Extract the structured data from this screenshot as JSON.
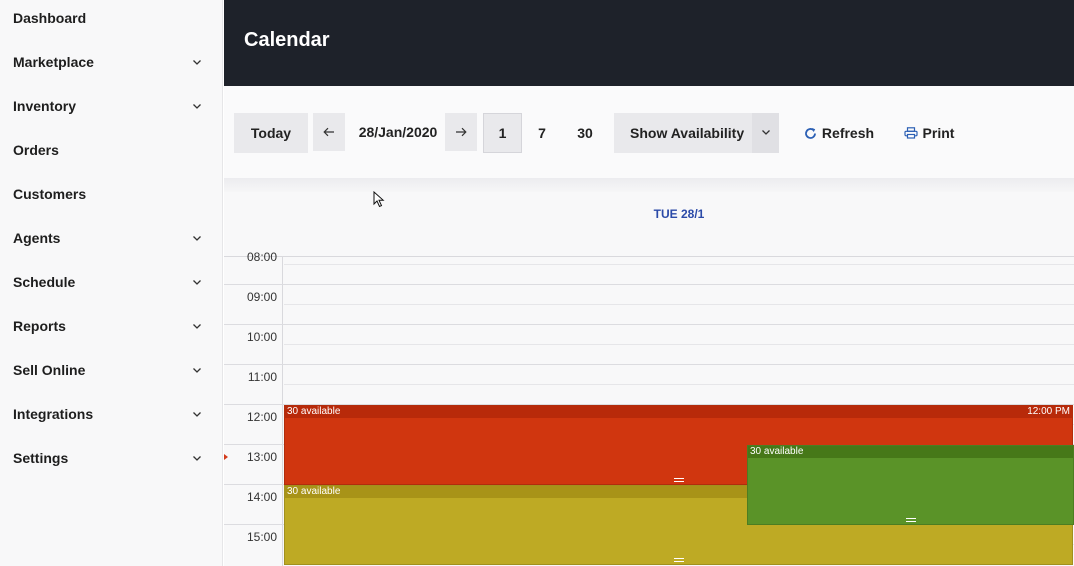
{
  "sidebar": {
    "items": [
      {
        "label": "Dashboard",
        "expandable": false
      },
      {
        "label": "Marketplace",
        "expandable": true
      },
      {
        "label": "Inventory",
        "expandable": true
      },
      {
        "label": "Orders",
        "expandable": false
      },
      {
        "label": "Customers",
        "expandable": false
      },
      {
        "label": "Agents",
        "expandable": true
      },
      {
        "label": "Schedule",
        "expandable": true
      },
      {
        "label": "Reports",
        "expandable": true
      },
      {
        "label": "Sell Online",
        "expandable": true
      },
      {
        "label": "Integrations",
        "expandable": true
      },
      {
        "label": "Settings",
        "expandable": true
      }
    ]
  },
  "header": {
    "title": "Calendar"
  },
  "toolbar": {
    "today_label": "Today",
    "prev_icon": "arrow-left-icon",
    "date_label": "28/Jan/2020",
    "next_icon": "arrow-right-icon",
    "day_1": "1",
    "day_7": "7",
    "day_30": "30",
    "availability_label": "Show Availability",
    "refresh_label": "Refresh",
    "print_label": "Print"
  },
  "calendar": {
    "day_header": "TUE 28/1",
    "time_labels": [
      "08:00",
      "09:00",
      "10:00",
      "11:00",
      "12:00",
      "13:00",
      "14:00",
      "15:00"
    ],
    "events": [
      {
        "title": "30 available",
        "time": "12:00 PM",
        "color": "#d0360f",
        "head_color": "#b82a0a"
      },
      {
        "title": "30 available",
        "time": "",
        "color": "#5a9328",
        "head_color": "#467818"
      },
      {
        "title": "30 available",
        "time": "",
        "color": "#beaa24",
        "head_color": "#a89318"
      }
    ]
  },
  "colors": {
    "header_bg": "#1e222a",
    "day_header": "#2b4aa8",
    "refresh_icon": "#2b5fb4",
    "print_icon": "#2b5fb4"
  }
}
